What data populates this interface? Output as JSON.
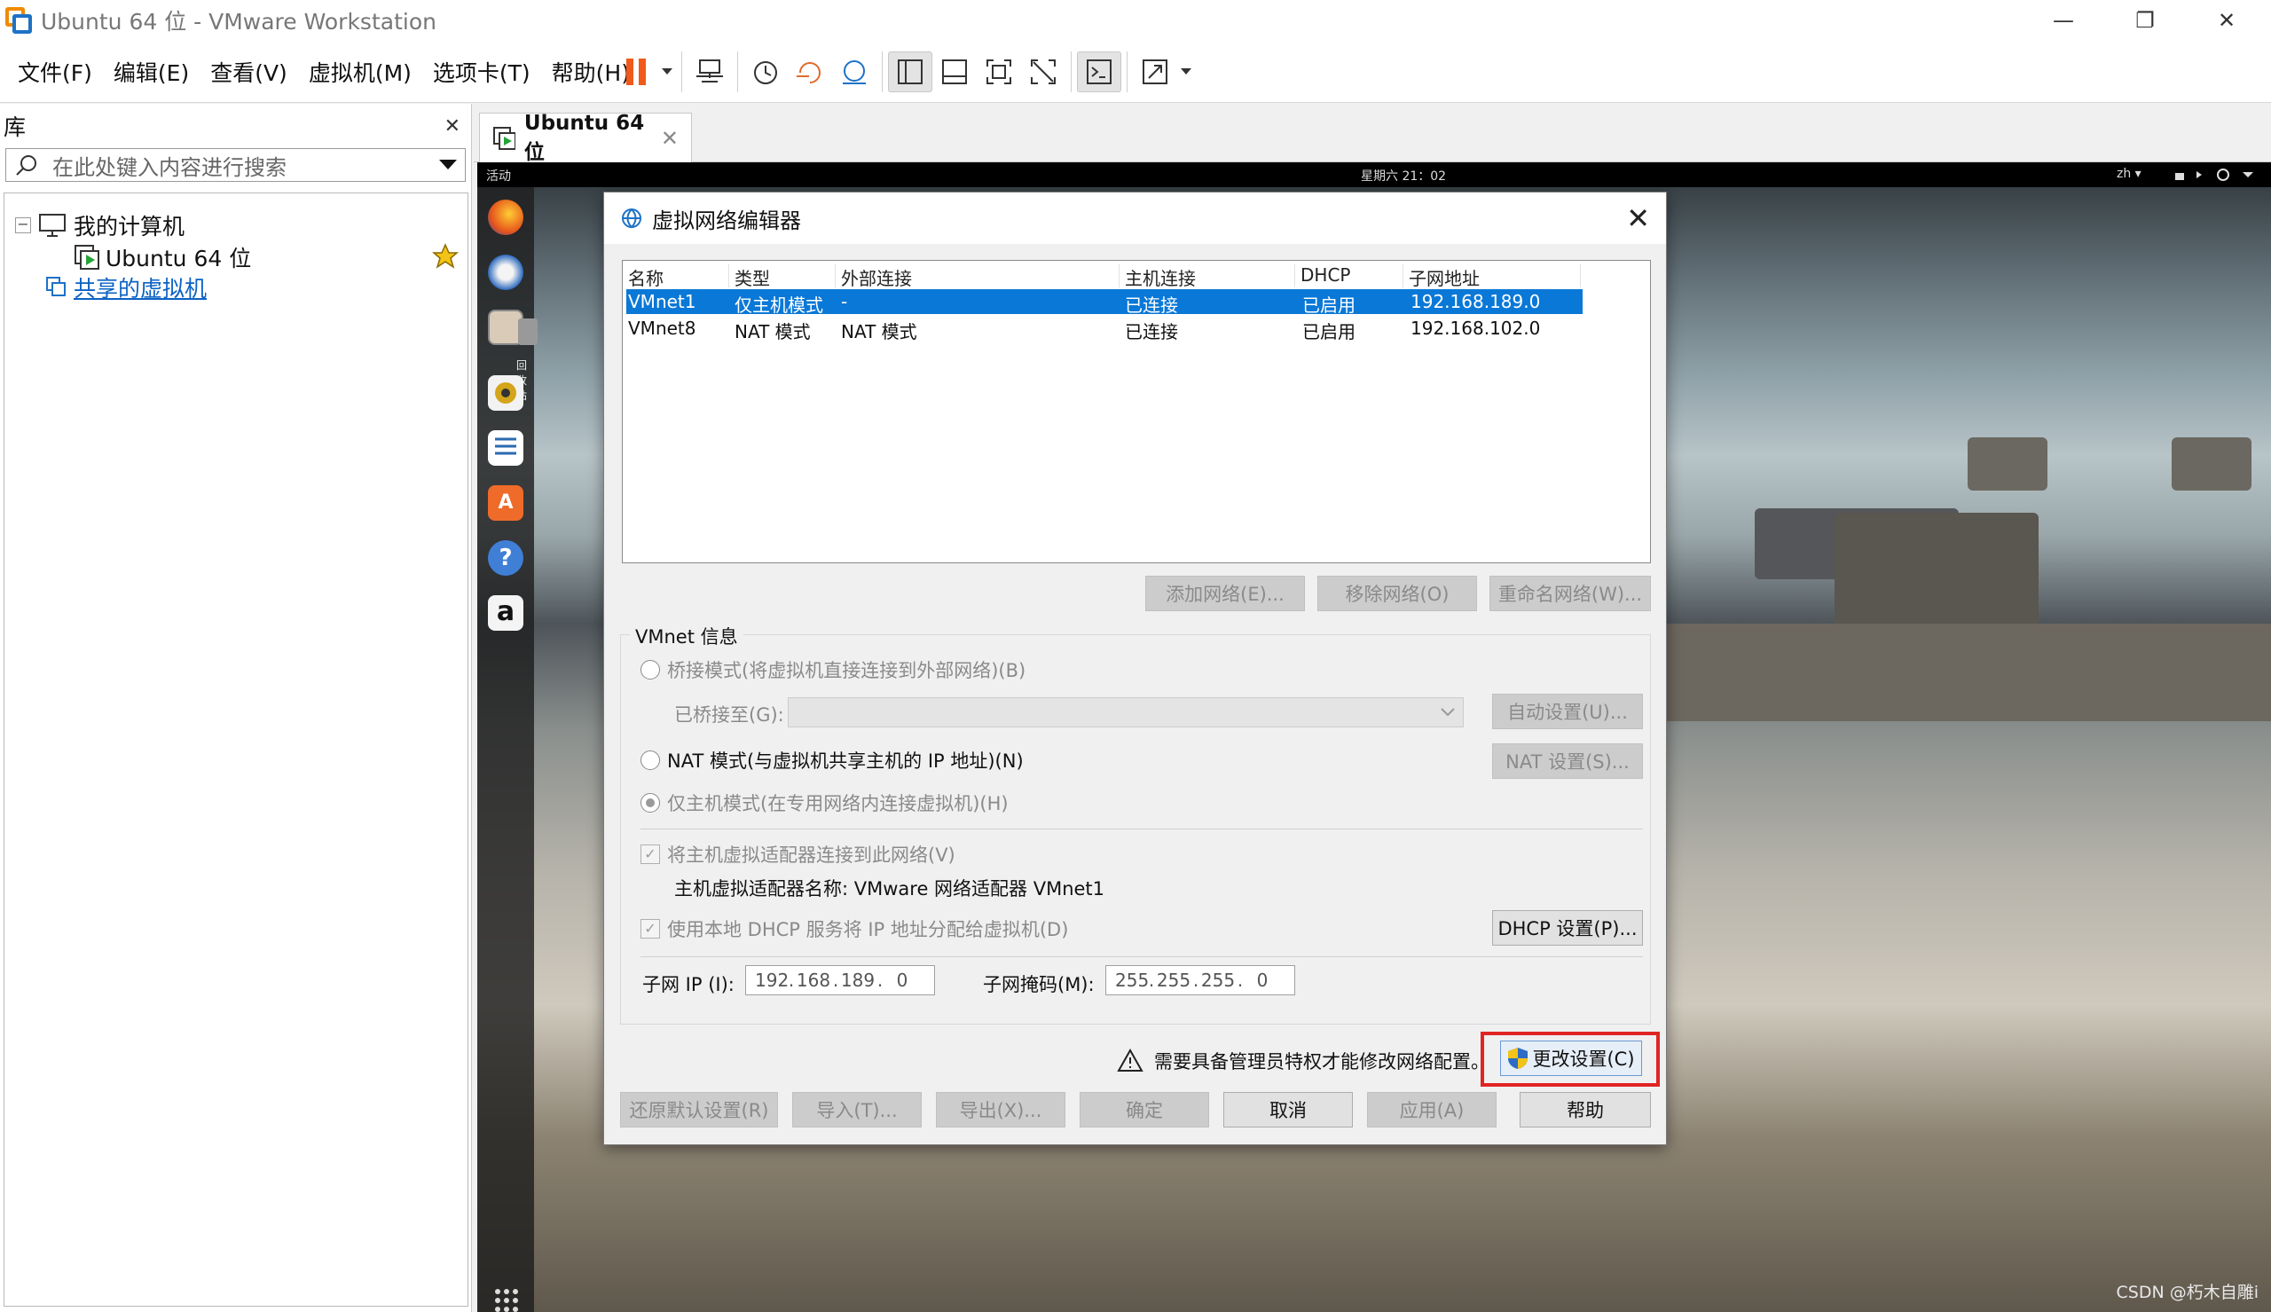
{
  "window": {
    "title": "Ubuntu 64 位 - VMware Workstation",
    "controls": {
      "minimize": "—",
      "restore": "❐",
      "close": "✕"
    }
  },
  "menu": [
    "文件(F)",
    "编辑(E)",
    "查看(V)",
    "虚拟机(M)",
    "选项卡(T)",
    "帮助(H)"
  ],
  "library": {
    "title": "库",
    "close": "✕",
    "search_placeholder": "在此处键入内容进行搜索",
    "tree": {
      "expander": "−",
      "root": "我的计算机",
      "vm": "Ubuntu 64 位",
      "shared": "共享的虚拟机"
    }
  },
  "tab": {
    "label": "Ubuntu 64 位",
    "close": "✕"
  },
  "guest": {
    "activities": "活动",
    "clock": "星期六 21：02",
    "lang": "zh ▾",
    "trash_label": "回收站",
    "amazon": "a",
    "help": "?",
    "watermark": "CSDN @朽木自雕i"
  },
  "dialog": {
    "title": "虚拟网络编辑器",
    "close": "✕",
    "columns": [
      "名称",
      "类型",
      "外部连接",
      "主机连接",
      "DHCP",
      "子网地址"
    ],
    "networks": [
      {
        "name": "VMnet1",
        "type": "仅主机模式",
        "external": "-",
        "host": "已连接",
        "dhcp": "已启用",
        "subnet": "192.168.189.0",
        "selected": true
      },
      {
        "name": "VMnet8",
        "type": "NAT 模式",
        "external": "NAT 模式",
        "host": "已连接",
        "dhcp": "已启用",
        "subnet": "192.168.102.0",
        "selected": false
      }
    ],
    "table_buttons": {
      "add": "添加网络(E)...",
      "remove": "移除网络(O)",
      "rename": "重命名网络(W)..."
    },
    "vmnet_info": {
      "label": "VMnet 信息",
      "bridged": "桥接模式(将虚拟机直接连接到外部网络)(B)",
      "bridged_to": "已桥接至(G):",
      "auto_settings": "自动设置(U)...",
      "nat": "NAT 模式(与虚拟机共享主机的 IP 地址)(N)",
      "nat_settings": "NAT 设置(S)...",
      "host_only": "仅主机模式(在专用网络内连接虚拟机)(H)",
      "connect_adapter": "将主机虚拟适配器连接到此网络(V)",
      "adapter_name": "主机虚拟适配器名称: VMware 网络适配器 VMnet1",
      "use_dhcp": "使用本地 DHCP 服务将 IP 地址分配给虚拟机(D)",
      "dhcp_settings": "DHCP 设置(P)...",
      "subnet_ip_label": "子网 IP (I):",
      "subnet_ip": [
        "192",
        "168",
        "189",
        "0"
      ],
      "subnet_mask_label": "子网掩码(M):",
      "subnet_mask": [
        "255",
        "255",
        "255",
        "0"
      ]
    },
    "admin_notice": "需要具备管理员特权才能修改网络配置。",
    "change_settings": "更改设置(C)",
    "bottom_buttons": {
      "restore": "还原默认设置(R)",
      "import": "导入(T)...",
      "export": "导出(X)...",
      "ok": "确定",
      "cancel": "取消",
      "apply": "应用(A)",
      "help": "帮助"
    }
  },
  "colors": {
    "selection": "#0a78d7",
    "highlight": "#e02424",
    "pause": "#f05a1a",
    "link": "#0b62c4"
  }
}
